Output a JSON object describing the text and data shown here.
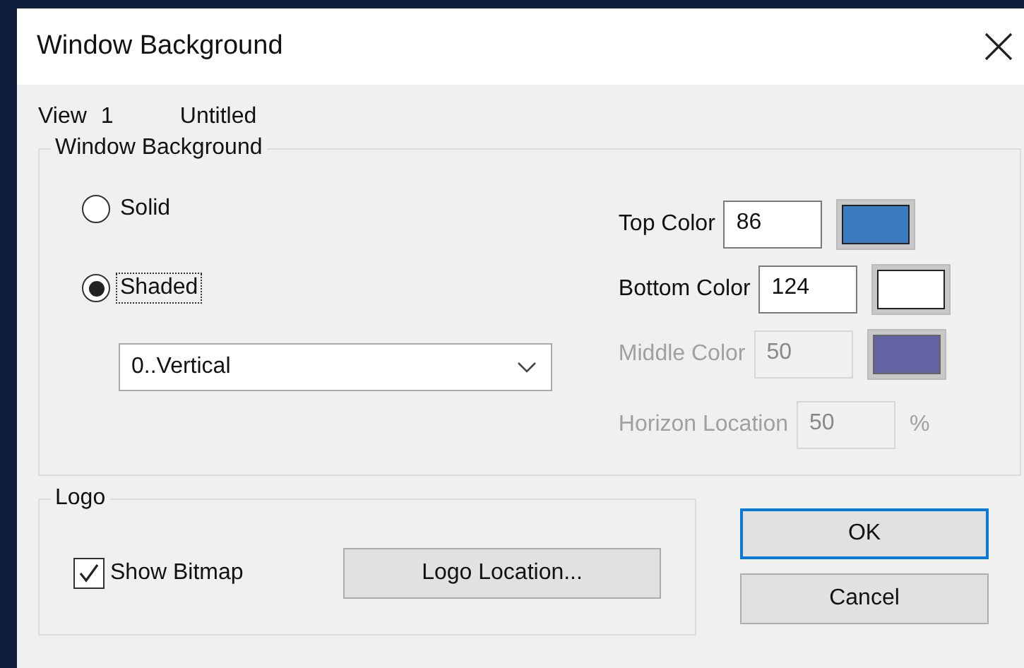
{
  "window": {
    "title": "Window Background"
  },
  "view": {
    "label": "View",
    "number": "1",
    "name": "Untitled"
  },
  "background_group": {
    "title": "Window Background",
    "fill_modes": [
      {
        "label": "Solid",
        "selected": false,
        "focused": false
      },
      {
        "label": "Shaded",
        "selected": true,
        "focused": true
      }
    ],
    "direction": {
      "value": "0..Vertical"
    },
    "settings": [
      {
        "kind": "color",
        "label": "Top Color",
        "value": "86",
        "disabled": false,
        "color": "#3b7cc0"
      },
      {
        "kind": "color",
        "label": "Bottom Color",
        "value": "124",
        "disabled": false,
        "color": "#ffffff"
      },
      {
        "kind": "color",
        "label": "Middle Color",
        "value": "50",
        "disabled": true,
        "color": "#6562a4"
      },
      {
        "kind": "location",
        "label": "Horizon Location",
        "value": "50",
        "disabled": true,
        "unit": "%"
      }
    ]
  },
  "logo_group": {
    "title": "Logo",
    "show_bitmap": {
      "label": "Show Bitmap",
      "checked": true
    },
    "location_button": "Logo Location..."
  },
  "buttons": [
    {
      "label": "OK",
      "default": true
    },
    {
      "label": "Cancel",
      "default": false
    }
  ]
}
